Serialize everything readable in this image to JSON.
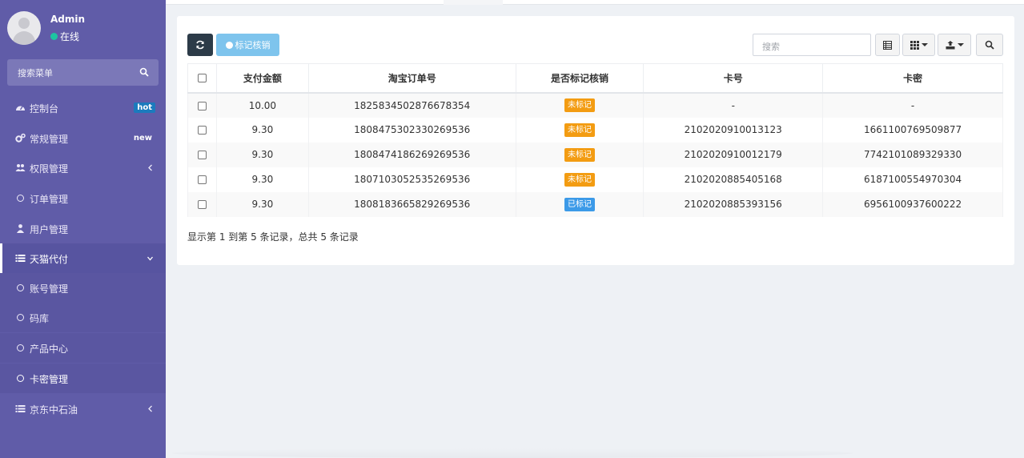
{
  "sidebar": {
    "user": {
      "name": "Admin",
      "status": "在线",
      "status_color": "#1dc5a1"
    },
    "search_placeholder": "搜索菜单",
    "items": [
      {
        "label": "控制台",
        "icon": "dashboard-icon",
        "badge": "hot"
      },
      {
        "label": "常规管理",
        "icon": "cogs-icon",
        "badge": "new"
      },
      {
        "label": "权限管理",
        "icon": "users-icon",
        "arrow": "chevron-left-icon"
      },
      {
        "label": "订单管理",
        "icon": "circle-icon"
      },
      {
        "label": "用户管理",
        "icon": "user-icon"
      },
      {
        "label": "天猫代付",
        "icon": "list-icon",
        "arrow": "chevron-down-icon"
      },
      {
        "label": "账号管理",
        "icon": "circle-icon"
      },
      {
        "label": "码库",
        "icon": "circle-icon"
      },
      {
        "label": "产品中心",
        "icon": "circle-icon"
      },
      {
        "label": "卡密管理",
        "icon": "circle-icon"
      },
      {
        "label": "京东中石油",
        "icon": "list-icon",
        "arrow": "chevron-left-icon"
      }
    ]
  },
  "toolbar": {
    "mark_label": "标记核销",
    "search_placeholder": "搜索"
  },
  "table": {
    "headers": [
      "支付金额",
      "淘宝订单号",
      "是否标记核销",
      "卡号",
      "卡密"
    ],
    "rows": [
      {
        "amount": "10.00",
        "order": "1825834502876678354",
        "status": "未标记",
        "card": "-",
        "secret": "-"
      },
      {
        "amount": "9.30",
        "order": "1808475302330269536",
        "status": "未标记",
        "card": "2102020910013123",
        "secret": "1661100769509877"
      },
      {
        "amount": "9.30",
        "order": "1808474186269269536",
        "status": "未标记",
        "card": "2102020910012179",
        "secret": "7742101089329330"
      },
      {
        "amount": "9.30",
        "order": "1807103052535269536",
        "status": "未标记",
        "card": "2102020885405168",
        "secret": "6187100554970304"
      },
      {
        "amount": "9.30",
        "order": "1808183665829269536",
        "status": "已标记",
        "card": "2102020885393156",
        "secret": "6956100937600222"
      }
    ]
  },
  "pagination": {
    "info": "显示第 1 到第 5 条记录，总共 5 条记录"
  },
  "colors": {
    "sidebar": "#605ca8",
    "unmarked": "#f39c12",
    "marked": "#3c9ae8",
    "primary_dark": "#2c3b48",
    "mark_button": "#7ec4ed"
  }
}
